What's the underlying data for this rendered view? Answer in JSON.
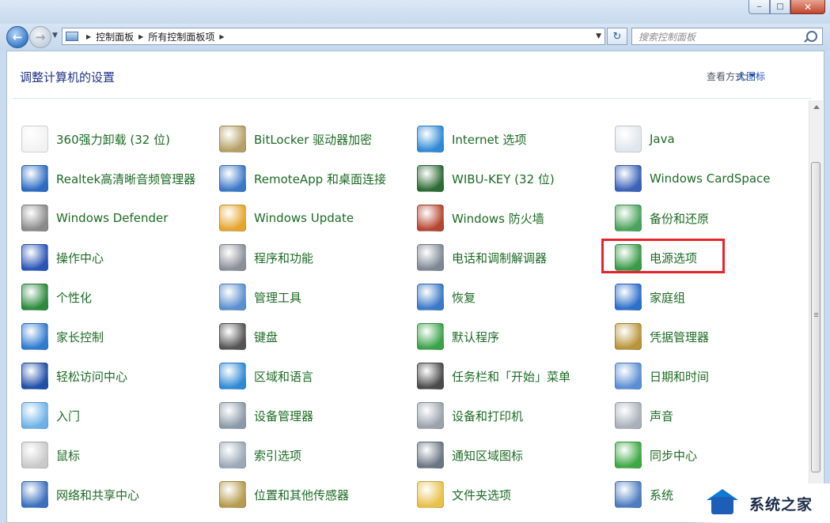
{
  "window": {
    "controls": {
      "minimize": "‒",
      "maximize": "□",
      "close": "✕"
    }
  },
  "nav": {
    "breadcrumbs": [
      "控制面板",
      "所有控制面板项"
    ],
    "search_placeholder": "搜索控制面板"
  },
  "header": {
    "title": "调整计算机的设置",
    "view_by_label": "查看方式:",
    "view_by_value": "大图标"
  },
  "columns": [
    [
      {
        "label": "360强力卸载 (32 位)",
        "icon": "document-icon",
        "color": "#f2f2f2"
      },
      {
        "label": "Realtek高清晰音频管理器",
        "icon": "audio-manager-icon",
        "color": "#2b6cc4"
      },
      {
        "label": "Windows Defender",
        "icon": "defender-castle-icon",
        "color": "#8a8a8a"
      },
      {
        "label": "操作中心",
        "icon": "action-center-flag-icon",
        "color": "#2a55b8"
      },
      {
        "label": "个性化",
        "icon": "personalization-monitor-icon",
        "color": "#2c8a3c"
      },
      {
        "label": "家长控制",
        "icon": "parental-controls-icon",
        "color": "#2f7bd0"
      },
      {
        "label": "轻松访问中心",
        "icon": "ease-of-access-icon",
        "color": "#1f4fa8"
      },
      {
        "label": "入门",
        "icon": "getting-started-icon",
        "color": "#6cb2e8"
      },
      {
        "label": "鼠标",
        "icon": "mouse-icon",
        "color": "#c9c9c9"
      },
      {
        "label": "网络和共享中心",
        "icon": "network-icon",
        "color": "#3a6fbf"
      }
    ],
    [
      {
        "label": "BitLocker 驱动器加密",
        "icon": "bitlocker-key-icon",
        "color": "#b4a064"
      },
      {
        "label": "RemoteApp 和桌面连接",
        "icon": "remoteapp-icon",
        "color": "#3b78c8"
      },
      {
        "label": "Windows Update",
        "icon": "windows-update-icon",
        "color": "#e5a52c"
      },
      {
        "label": "程序和功能",
        "icon": "programs-icon",
        "color": "#8a8f99"
      },
      {
        "label": "管理工具",
        "icon": "admin-tools-icon",
        "color": "#5a8fd0"
      },
      {
        "label": "键盘",
        "icon": "keyboard-icon",
        "color": "#555555"
      },
      {
        "label": "区域和语言",
        "icon": "region-globe-icon",
        "color": "#2f8ad6"
      },
      {
        "label": "设备管理器",
        "icon": "device-manager-icon",
        "color": "#8c9aa8"
      },
      {
        "label": "索引选项",
        "icon": "indexing-icon",
        "color": "#9aa8b8"
      },
      {
        "label": "位置和其他传感器",
        "icon": "location-sensor-icon",
        "color": "#b59b4d"
      }
    ],
    [
      {
        "label": "Internet 选项",
        "icon": "internet-globe-icon",
        "color": "#2f8ad6"
      },
      {
        "label": "WIBU-KEY (32 位)",
        "icon": "wibu-key-icon",
        "color": "#2d6b35"
      },
      {
        "label": "Windows 防火墙",
        "icon": "firewall-icon",
        "color": "#b6452f"
      },
      {
        "label": "电话和调制解调器",
        "icon": "phone-modem-icon",
        "color": "#7e8894"
      },
      {
        "label": "恢复",
        "icon": "recovery-icon",
        "color": "#3a78c8"
      },
      {
        "label": "默认程序",
        "icon": "default-programs-icon",
        "color": "#3ba24a"
      },
      {
        "label": "任务栏和「开始」菜单",
        "icon": "taskbar-icon",
        "color": "#4a4a4a"
      },
      {
        "label": "设备和打印机",
        "icon": "printer-icon",
        "color": "#9aa2ac"
      },
      {
        "label": "通知区域图标",
        "icon": "notification-icon",
        "color": "#6b7684"
      },
      {
        "label": "文件夹选项",
        "icon": "folder-options-icon",
        "color": "#e8c04a"
      }
    ],
    [
      {
        "label": "Java",
        "icon": "java-icon",
        "color": "#e0e6ee"
      },
      {
        "label": "Windows CardSpace",
        "icon": "cardspace-icon",
        "color": "#3a62b8"
      },
      {
        "label": "备份和还原",
        "icon": "backup-restore-icon",
        "color": "#4aa35a"
      },
      {
        "label": "电源选项",
        "icon": "power-options-icon",
        "color": "#3b9a48"
      },
      {
        "label": "家庭组",
        "icon": "homegroup-icon",
        "color": "#2d6fcb"
      },
      {
        "label": "凭据管理器",
        "icon": "credential-manager-icon",
        "color": "#b8953a"
      },
      {
        "label": "日期和时间",
        "icon": "date-time-icon",
        "color": "#5b8fd4"
      },
      {
        "label": "声音",
        "icon": "sound-icon",
        "color": "#a8b0bb"
      },
      {
        "label": "同步中心",
        "icon": "sync-center-icon",
        "color": "#3da843"
      },
      {
        "label": "系统",
        "icon": "system-icon",
        "color": "#4d7cc0"
      }
    ]
  ],
  "watermark": {
    "text": "系统之家"
  }
}
